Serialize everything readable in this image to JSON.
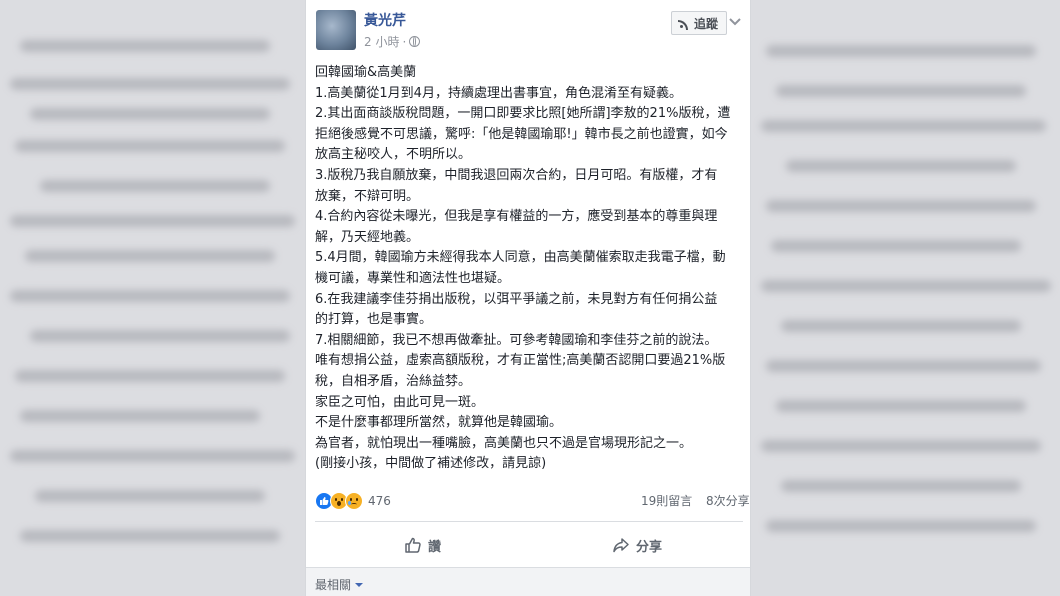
{
  "post": {
    "author": "黃光芹",
    "time": "2 小時",
    "time_separator": "·",
    "privacy_icon": "globe-icon",
    "follow_label": "追蹤",
    "follow_icon": "rss-icon",
    "more_icon": "chevron-down-icon",
    "lines": [
      "回韓國瑜&高美蘭",
      "1.高美蘭從1月到4月，持續處理出書事宜，角色混淆至有疑義。",
      "2.其出面商談版稅問題，一開口即要求比照[她所謂]李敖的21%版稅，遭",
      "拒絕後感覺不可思議，驚呼:「他是韓國瑜耶!」韓市長之前也證實，如今",
      "放高主秘咬人，不明所以。",
      "3.版稅乃我自願放棄，中間我退回兩次合約，日月可昭。有版權，才有",
      "放棄，不辯可明。",
      "4.合約內容從未曝光，但我是享有權益的一方，應受到基本的尊重與理",
      "解，乃天經地義。",
      "5.4月間，韓國瑜方未經得我本人同意，由高美蘭催索取走我電子檔，動",
      "機可議，專業性和適法性也堪疑。",
      "6.在我建議李佳芬捐出版稅，以弭平爭議之前，未見對方有任何捐公益",
      "的打算，也是事實。",
      "7.相關細節，我已不想再做牽扯。可參考韓國瑜和李佳芬之前的說法。",
      "唯有想捐公益，虛索高額版稅，才有正當性;高美蘭否認開口要過21%版",
      "稅，自相矛盾，治絲益棼。",
      "家臣之可怕，由此可見一斑。",
      "不是什麼事都理所當然，就算他是韓國瑜。",
      "為官者，就怕現出一種嘴臉，高美蘭也只不過是官場現形記之一。",
      "(剛接小孩，中間做了補述修改，請見諒)"
    ],
    "reactions": {
      "icons": [
        "like-reaction-icon",
        "wow-reaction-icon",
        "sad-reaction-icon"
      ],
      "count": "476"
    },
    "stats": {
      "comments": "19則留言",
      "shares": "8次分享"
    },
    "actions": {
      "like_label": "讚",
      "share_label": "分享"
    },
    "comments": {
      "sort_label": "最相關"
    }
  },
  "colors": {
    "link_blue": "#385898",
    "meta_gray": "#90949c",
    "text": "#1d2129",
    "like_blue": "#1877f2",
    "reaction_yellow": "#f7b125"
  }
}
